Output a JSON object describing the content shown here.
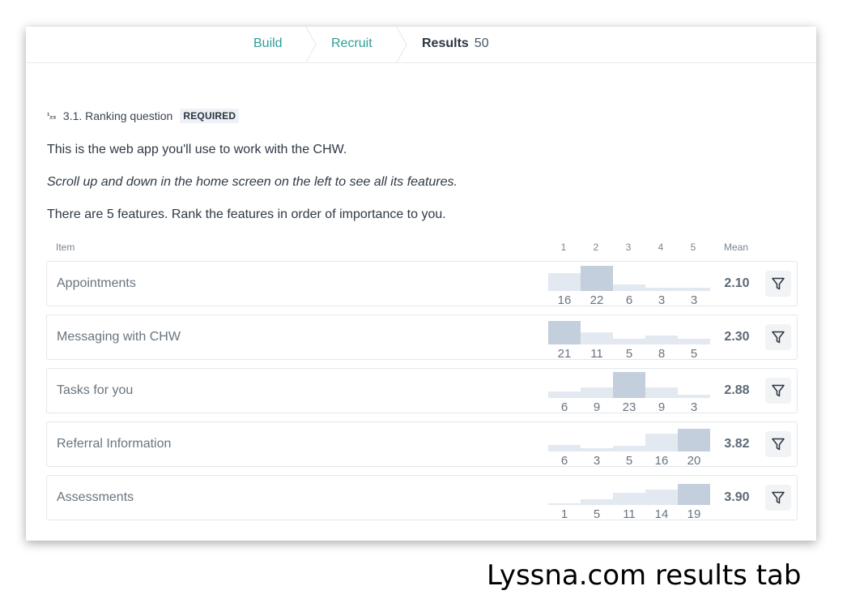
{
  "tabs": [
    {
      "label": "Build"
    },
    {
      "label": "Recruit"
    },
    {
      "label": "Results",
      "count": "50"
    }
  ],
  "question": {
    "icon": "ranking-icon",
    "icon_glyph": "¹₂₃",
    "title": "3.1. Ranking question",
    "badge": "REQUIRED",
    "p1": "This is the web app you'll use to work with the CHW.",
    "p2": "Scroll up and down in the home screen on the left to see all its features.",
    "p3": "There are 5 features. Rank the features in order of importance to you."
  },
  "table": {
    "header_item": "Item",
    "rank_headers": [
      "1",
      "2",
      "3",
      "4",
      "5"
    ],
    "header_mean": "Mean",
    "rows": [
      {
        "label": "Appointments",
        "counts": [
          16,
          22,
          6,
          3,
          3
        ],
        "mean": "2.10"
      },
      {
        "label": "Messaging with CHW",
        "counts": [
          21,
          11,
          5,
          8,
          5
        ],
        "mean": "2.30"
      },
      {
        "label": "Tasks for you",
        "counts": [
          6,
          9,
          23,
          9,
          3
        ],
        "mean": "2.88"
      },
      {
        "label": "Referral Information",
        "counts": [
          6,
          3,
          5,
          16,
          20
        ],
        "mean": "3.82"
      },
      {
        "label": "Assessments",
        "counts": [
          1,
          5,
          11,
          14,
          19
        ],
        "mean": "3.90"
      }
    ]
  },
  "colors": {
    "accent": "#2e9e96",
    "bar_strong": "#c3cfdc",
    "bar_light": "#e3e9f0"
  },
  "caption": "Lyssna.com results tab"
}
